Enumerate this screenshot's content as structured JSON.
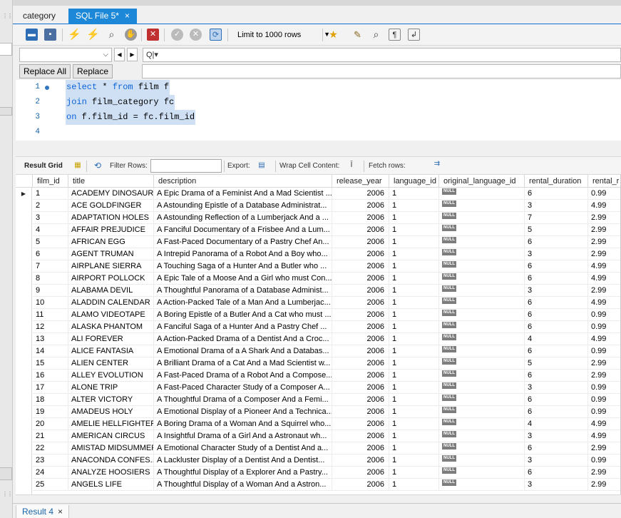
{
  "tabs": [
    {
      "label": "category"
    },
    {
      "label": "SQL File 5*",
      "close": "×"
    }
  ],
  "toolbar": {
    "limit_label": "Limit to 1000 rows"
  },
  "find": {
    "search_placeholder": "Q|▾",
    "replace_all": "Replace All",
    "replace": "Replace"
  },
  "editor": {
    "lines": [
      {
        "no": "1",
        "kw1": "select",
        "rest1": " * ",
        "kw2": "from",
        "rest2": " film f"
      },
      {
        "no": "2",
        "kw1": "join",
        "rest1": " film_category fc",
        "kw2": "",
        "rest2": ""
      },
      {
        "no": "3",
        "kw1": "on",
        "rest1": " f.film_id = fc.film_id",
        "kw2": "",
        "rest2": ""
      },
      {
        "no": "4",
        "kw1": "",
        "rest1": "",
        "kw2": "",
        "rest2": ""
      }
    ]
  },
  "results_toolbar": {
    "result_grid": "Result Grid",
    "filter_rows": "Filter Rows:",
    "export": "Export:",
    "wrap": "Wrap Cell Content:",
    "fetch": "Fetch rows:"
  },
  "grid": {
    "columns": [
      "film_id",
      "title",
      "description",
      "release_year",
      "language_id",
      "original_language_id",
      "rental_duration",
      "rental_r"
    ],
    "null_label": "NULL",
    "rows": [
      [
        "1",
        "ACADEMY DINOSAUR",
        "A Epic Drama of a Feminist And a Mad Scientist ...",
        "2006",
        "1",
        "6",
        "0.99"
      ],
      [
        "2",
        "ACE GOLDFINGER",
        "A Astounding Epistle of a Database Administrat...",
        "2006",
        "1",
        "3",
        "4.99"
      ],
      [
        "3",
        "ADAPTATION HOLES",
        "A Astounding Reflection of a Lumberjack And a ...",
        "2006",
        "1",
        "7",
        "2.99"
      ],
      [
        "4",
        "AFFAIR PREJUDICE",
        "A Fanciful Documentary of a Frisbee And a Lum...",
        "2006",
        "1",
        "5",
        "2.99"
      ],
      [
        "5",
        "AFRICAN EGG",
        "A Fast-Paced Documentary of a Pastry Chef An...",
        "2006",
        "1",
        "6",
        "2.99"
      ],
      [
        "6",
        "AGENT TRUMAN",
        "A Intrepid Panorama of a Robot And a Boy who...",
        "2006",
        "1",
        "3",
        "2.99"
      ],
      [
        "7",
        "AIRPLANE SIERRA",
        "A Touching Saga of a Hunter And a Butler who ...",
        "2006",
        "1",
        "6",
        "4.99"
      ],
      [
        "8",
        "AIRPORT POLLOCK",
        "A Epic Tale of a Moose And a Girl who must Con...",
        "2006",
        "1",
        "6",
        "4.99"
      ],
      [
        "9",
        "ALABAMA DEVIL",
        "A Thoughtful Panorama of a Database Administ...",
        "2006",
        "1",
        "3",
        "2.99"
      ],
      [
        "10",
        "ALADDIN CALENDAR",
        "A Action-Packed Tale of a Man And a Lumberjac...",
        "2006",
        "1",
        "6",
        "4.99"
      ],
      [
        "11",
        "ALAMO VIDEOTAPE",
        "A Boring Epistle of a Butler And a Cat who must ...",
        "2006",
        "1",
        "6",
        "0.99"
      ],
      [
        "12",
        "ALASKA PHANTOM",
        "A Fanciful Saga of a Hunter And a Pastry Chef ...",
        "2006",
        "1",
        "6",
        "0.99"
      ],
      [
        "13",
        "ALI FOREVER",
        "A Action-Packed Drama of a Dentist And a Croc...",
        "2006",
        "1",
        "4",
        "4.99"
      ],
      [
        "14",
        "ALICE FANTASIA",
        "A Emotional Drama of a A Shark And a Databas...",
        "2006",
        "1",
        "6",
        "0.99"
      ],
      [
        "15",
        "ALIEN CENTER",
        "A Brilliant Drama of a Cat And a Mad Scientist w...",
        "2006",
        "1",
        "5",
        "2.99"
      ],
      [
        "16",
        "ALLEY EVOLUTION",
        "A Fast-Paced Drama of a Robot And a Compose...",
        "2006",
        "1",
        "6",
        "2.99"
      ],
      [
        "17",
        "ALONE TRIP",
        "A Fast-Paced Character Study of a Composer A...",
        "2006",
        "1",
        "3",
        "0.99"
      ],
      [
        "18",
        "ALTER VICTORY",
        "A Thoughtful Drama of a Composer And a Femi...",
        "2006",
        "1",
        "6",
        "0.99"
      ],
      [
        "19",
        "AMADEUS HOLY",
        "A Emotional Display of a Pioneer And a Technica...",
        "2006",
        "1",
        "6",
        "0.99"
      ],
      [
        "20",
        "AMELIE HELLFIGHTERS",
        "A Boring Drama of a Woman And a Squirrel who...",
        "2006",
        "1",
        "4",
        "4.99"
      ],
      [
        "21",
        "AMERICAN CIRCUS",
        "A Insightful Drama of a Girl And a Astronaut wh...",
        "2006",
        "1",
        "3",
        "4.99"
      ],
      [
        "22",
        "AMISTAD MIDSUMMER",
        "A Emotional Character Study of a Dentist And a...",
        "2006",
        "1",
        "6",
        "2.99"
      ],
      [
        "23",
        "ANACONDA CONFES...",
        "A Lackluster Display of a Dentist And a Dentist...",
        "2006",
        "1",
        "3",
        "0.99"
      ],
      [
        "24",
        "ANALYZE HOOSIERS",
        "A Thoughtful Display of a Explorer And a Pastry...",
        "2006",
        "1",
        "6",
        "2.99"
      ],
      [
        "25",
        "ANGELS LIFE",
        "A Thoughtful Display of a Woman And a Astron...",
        "2006",
        "1",
        "3",
        "2.99"
      ]
    ]
  },
  "bottom_tab": {
    "label": "Result 4",
    "close": "×"
  }
}
